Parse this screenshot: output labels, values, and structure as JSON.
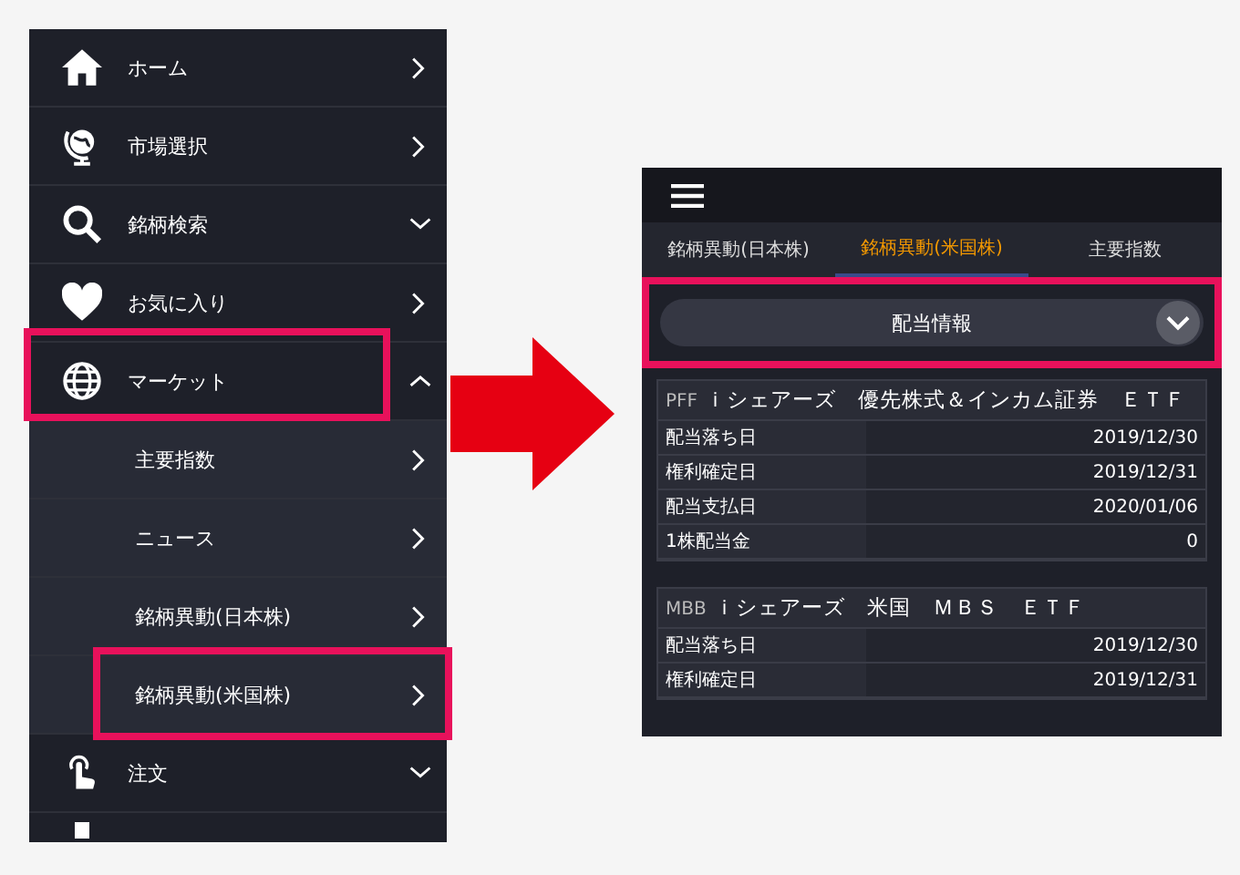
{
  "menu": {
    "items": [
      {
        "label": "ホーム",
        "kind": "link",
        "highlighted": false
      },
      {
        "label": "市場選択",
        "kind": "link",
        "highlighted": false
      },
      {
        "label": "銘柄検索",
        "kind": "group",
        "expanded": false,
        "highlighted": false
      },
      {
        "label": "お気に入り",
        "kind": "link",
        "highlighted": false
      },
      {
        "label": "マーケット",
        "kind": "group",
        "expanded": true,
        "highlighted": true,
        "children": [
          {
            "label": "主要指数",
            "highlighted": false
          },
          {
            "label": "ニュース",
            "highlighted": false
          },
          {
            "label": "銘柄異動(日本株)",
            "highlighted": false
          },
          {
            "label": "銘柄異動(米国株)",
            "highlighted": true
          }
        ]
      },
      {
        "label": "注文",
        "kind": "group",
        "expanded": false,
        "highlighted": false
      },
      {
        "kind": "partial"
      }
    ]
  },
  "screen": {
    "tabs": [
      {
        "label": "銘柄異動(日本株)",
        "selected": false
      },
      {
        "label": "銘柄異動(米国株)",
        "selected": true
      },
      {
        "label": "主要指数",
        "selected": false
      }
    ],
    "dropdown": {
      "value": "配当情報",
      "highlighted": true
    },
    "cards": [
      {
        "ticker": "PFF",
        "name": "ｉシェアーズ　優先株式＆インカム証券　ＥＴＦ",
        "rows": [
          {
            "label": "配当落ち日",
            "value": "2019/12/30"
          },
          {
            "label": "権利確定日",
            "value": "2019/12/31"
          },
          {
            "label": "配当支払日",
            "value": "2020/01/06"
          },
          {
            "label": "1株配当金",
            "value": "0"
          }
        ]
      },
      {
        "ticker": "MBB",
        "name": "ｉシェアーズ　米国　ＭＢＳ　ＥＴＦ",
        "rows": [
          {
            "label": "配当落ち日",
            "value": "2019/12/30"
          },
          {
            "label": "権利確定日",
            "value": "2019/12/31"
          }
        ]
      }
    ]
  }
}
